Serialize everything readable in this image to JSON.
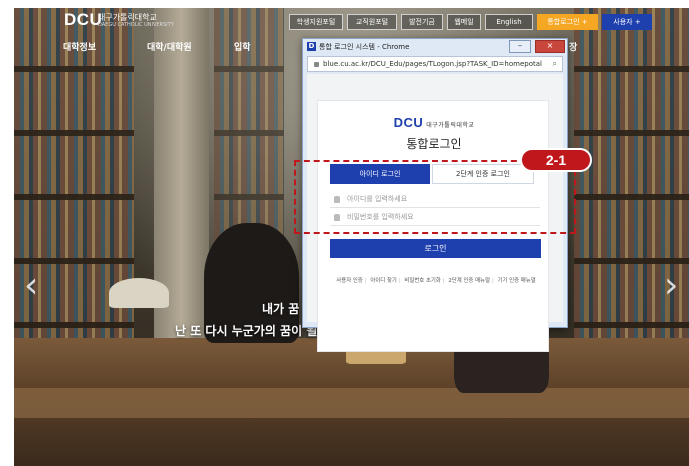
{
  "site": {
    "logo": "DCU",
    "logo_sub": "대구가톨릭대학교",
    "logo_sub_en": "DAEGU CATHOLIC UNIVERSITY",
    "top_buttons": [
      "학생지원포털",
      "교직원포털",
      "발전기금",
      "웹메일",
      "English",
      "통합로그인 +",
      "사용자 +"
    ],
    "nav": [
      "대학정보",
      "대학/대학원",
      "입학",
      "장"
    ],
    "hero_line1": "내가 꿈",
    "hero_line2": "난 또 다시 누군가의 꿈이 될 것이",
    "colors": {
      "accent_blue": "#1e3fae",
      "accent_orange": "#f5a623",
      "highlight_red": "#c0171d"
    }
  },
  "popup": {
    "title": "통합 로그인 시스템 - Chrome",
    "url": "blue.cu.ac.kr/DCU_Edu/pages/TLogon.jsp?TASK_ID=homepotal",
    "controls": [
      "–",
      "□",
      "×"
    ],
    "brand": "DCU",
    "brand_sub": "대구가톨릭대학교",
    "login_title": "통합로그인",
    "tabs": [
      {
        "label": "아이디 로그인",
        "active": true
      },
      {
        "label": "2단계 인증 로그인",
        "active": false
      }
    ],
    "id_placeholder": "아이디를 입력하세요",
    "pw_placeholder": "비밀번호를 입력하세요",
    "login_button": "로그인",
    "links": [
      "사용자 인증",
      "아이디 찾기",
      "비밀번호 초기화",
      "2단계 인증 매뉴얼",
      "기기 인증 매뉴얼"
    ]
  },
  "annotation": {
    "badge": "2-1"
  },
  "icons": [
    "lock-icon",
    "search-icon",
    "user-icon",
    "key-icon",
    "chevron-left-icon",
    "chevron-right-icon"
  ]
}
